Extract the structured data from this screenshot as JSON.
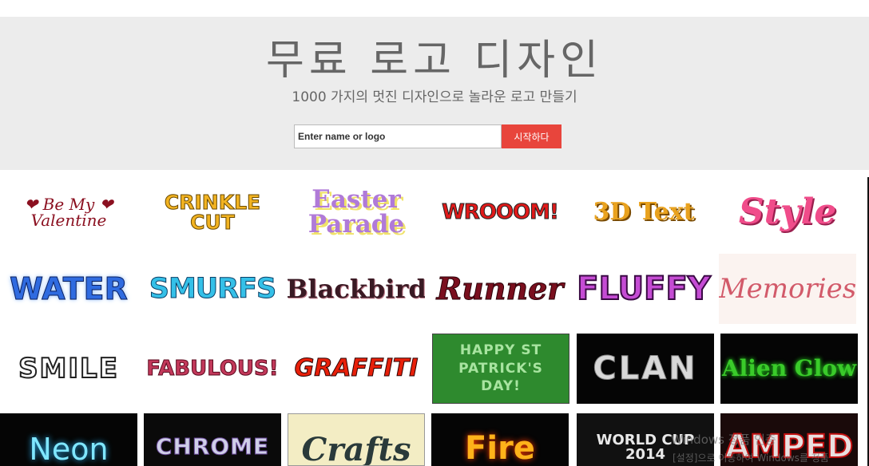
{
  "hero": {
    "title": "무료 로고 디자인",
    "subtitle": "1000 가지의 멋진 디자인으로 놀라운 로고 만들기",
    "search_placeholder": "Enter name or logo",
    "search_button": "시작하다"
  },
  "logos": [
    [
      "❤ Be My ❤ Valentine",
      "CRINKLE CUT",
      "Easter Parade",
      "WROOOM!",
      "3D Text",
      "Style"
    ],
    [
      "WATER",
      "SMURFS",
      "Blackbird",
      "Runner",
      "FLUFFY",
      "Memories"
    ],
    [
      "SMILE",
      "FABULOUS!",
      "GRAFFITI",
      "HAPPY ST PATRICK'S DAY!",
      "CLAN",
      "Alien Glow"
    ],
    [
      "Neon",
      "CHROME",
      "Crafts",
      "Fire",
      "WORLD CUP 2014",
      "AMPED"
    ]
  ],
  "watermark": {
    "line1": "Windows 정품 인증",
    "line2": "[설정]으로 이동하여 Windows를 정품"
  }
}
